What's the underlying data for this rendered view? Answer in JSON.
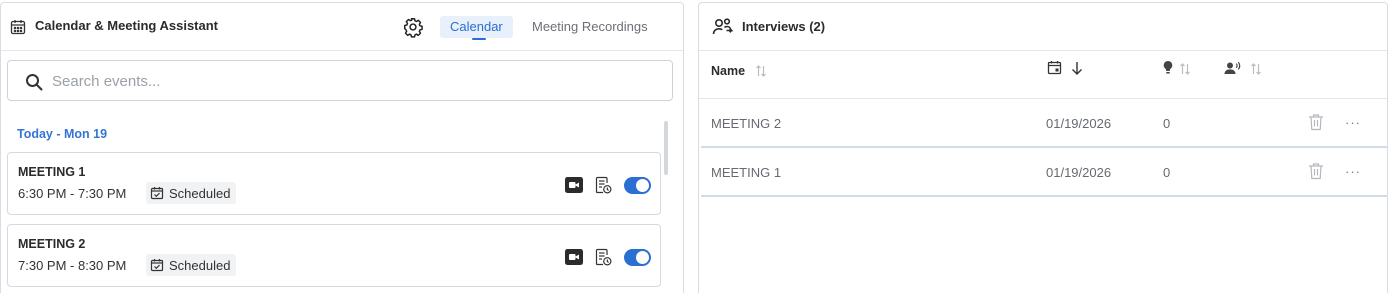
{
  "left": {
    "title": "Calendar & Meeting Assistant",
    "tabs": [
      {
        "label": "Calendar",
        "active": true
      },
      {
        "label": "Meeting Recordings",
        "active": false
      }
    ],
    "search": {
      "placeholder": "Search events...",
      "value": ""
    },
    "date_heading": "Today - Mon 19",
    "events": [
      {
        "title": "MEETING 1",
        "time": "6:30 PM - 7:30 PM",
        "status": "Scheduled",
        "enabled": true
      },
      {
        "title": "MEETING 2",
        "time": "7:30 PM - 8:30 PM",
        "status": "Scheduled",
        "enabled": true
      }
    ]
  },
  "right": {
    "title": "Interviews (2)",
    "columns": {
      "name": "Name"
    },
    "rows": [
      {
        "name": "MEETING 2",
        "date": "01/19/2026",
        "count": "0"
      },
      {
        "name": "MEETING 1",
        "date": "01/19/2026",
        "count": "0"
      }
    ]
  },
  "colors": {
    "accent": "#2a6fd1",
    "accent_bg": "#e7f0fb",
    "border": "#d9dde3"
  }
}
